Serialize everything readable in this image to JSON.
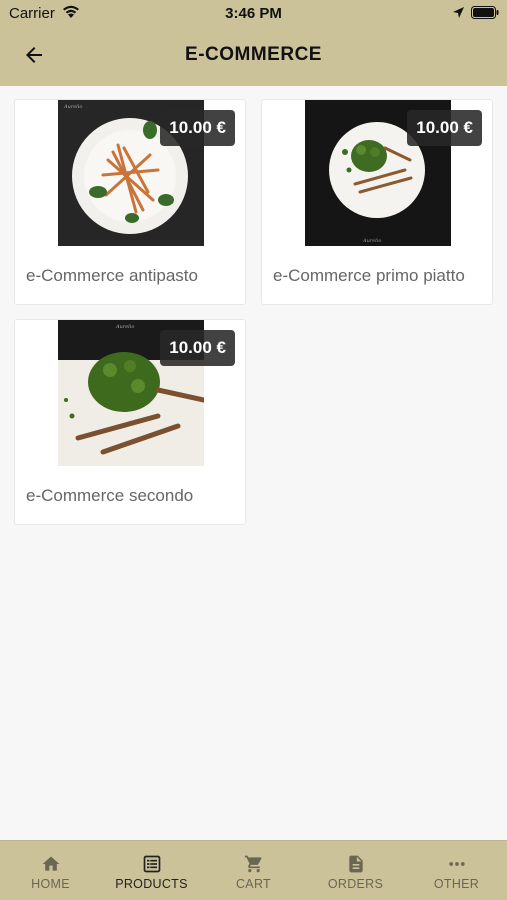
{
  "status_bar": {
    "carrier": "Carrier",
    "time": "3:46 PM"
  },
  "nav": {
    "title": "E-COMMERCE"
  },
  "products": [
    {
      "name": "e-Commerce antipasto",
      "price": "10.00 €"
    },
    {
      "name": "e-Commerce primo piatto",
      "price": "10.00 €"
    },
    {
      "name": "e-Commerce secondo",
      "price": "10.00 €"
    }
  ],
  "tabs": [
    {
      "label": "HOME",
      "icon": "home-icon"
    },
    {
      "label": "PRODUCTS",
      "icon": "list-icon",
      "active": true
    },
    {
      "label": "CART",
      "icon": "cart-icon"
    },
    {
      "label": "ORDERS",
      "icon": "document-icon"
    },
    {
      "label": "OTHER",
      "icon": "more-icon"
    }
  ],
  "colors": {
    "accent": "#cbc29a",
    "background": "#f7f7f7"
  }
}
